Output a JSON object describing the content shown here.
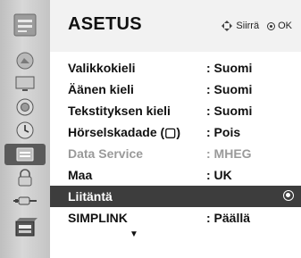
{
  "menu": {
    "title": "ASETUS",
    "hint_move": "Siirrä",
    "hint_ok": "OK"
  },
  "sidebar": {
    "icons": [
      "setup-icon",
      "picture-icon",
      "display-icon",
      "audio-icon",
      "time-icon",
      "option-icon",
      "lock-icon",
      "input-icon",
      "usb-icon"
    ]
  },
  "rows": [
    {
      "label": "Valikkokieli",
      "value": ": Suomi"
    },
    {
      "label": "Äänen kieli",
      "value": ": Suomi"
    },
    {
      "label": "Tekstityksen kieli",
      "value": ": Suomi"
    },
    {
      "label": "Hörselskadade (▢)",
      "value": ": Pois"
    },
    {
      "label": "Data Service",
      "value": ": MHEG"
    },
    {
      "label": "Maa",
      "value": ": UK"
    },
    {
      "label": "Liitäntä",
      "value": ""
    },
    {
      "label": "SIMPLINK",
      "value": ": Päällä"
    }
  ],
  "colors": {
    "selected_row": "#3d3d3d",
    "disabled_text": "#9a9a9a",
    "sidebar": "#cfcfcf"
  }
}
